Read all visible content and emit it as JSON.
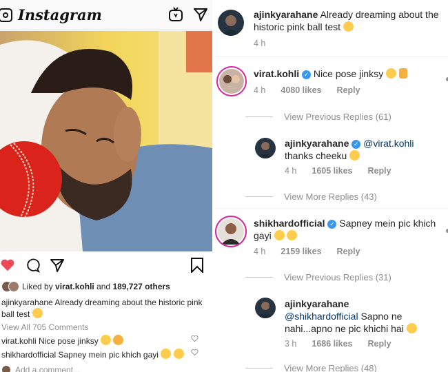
{
  "header": {
    "logo": "Instagram"
  },
  "post": {
    "likes_prefix": "Liked by",
    "liked_user": "virat.kohli",
    "likes_mid": "and",
    "likes_count": "189,727 others",
    "caption_user": "ajinkyarahane",
    "caption_text": "Already dreaming about the historic pink ball test",
    "view_all": "View All 705 Comments",
    "comments": [
      {
        "user": "virat.kohli",
        "text": "Nice pose jinksy"
      },
      {
        "user": "shikhardofficial",
        "text": "Sapney mein pic khich gayi"
      }
    ],
    "add_comment": "Add a comment..."
  },
  "thread": {
    "c1": {
      "user": "ajinkyarahane",
      "text": "Already dreaming about the historic pink ball test",
      "time": "4 h"
    },
    "c2": {
      "user": "virat.kohli",
      "text": "Nice pose jinksy",
      "time": "4 h",
      "likes": "4080 likes",
      "reply": "Reply"
    },
    "c2_view": "View Previous Replies (61)",
    "c3": {
      "user": "ajinkyarahane",
      "mention": "@virat.kohli",
      "text": "thanks cheeku",
      "time": "4 h",
      "likes": "1605 likes",
      "reply": "Reply"
    },
    "c3_view": "View More Replies (43)",
    "c4": {
      "user": "shikhardofficial",
      "text": "Sapney mein pic khich gayi",
      "time": "4 h",
      "likes": "2159 likes",
      "reply": "Reply"
    },
    "c4_view": "View Previous Replies (31)",
    "c5": {
      "user": "ajinkyarahane",
      "mention": "@shikhardofficial",
      "text": "Sapno ne nahi...apno ne pic khichi hai",
      "time": "3 h",
      "likes": "1686 likes",
      "reply": "Reply"
    },
    "c5_view": "View More Replies (48)"
  }
}
